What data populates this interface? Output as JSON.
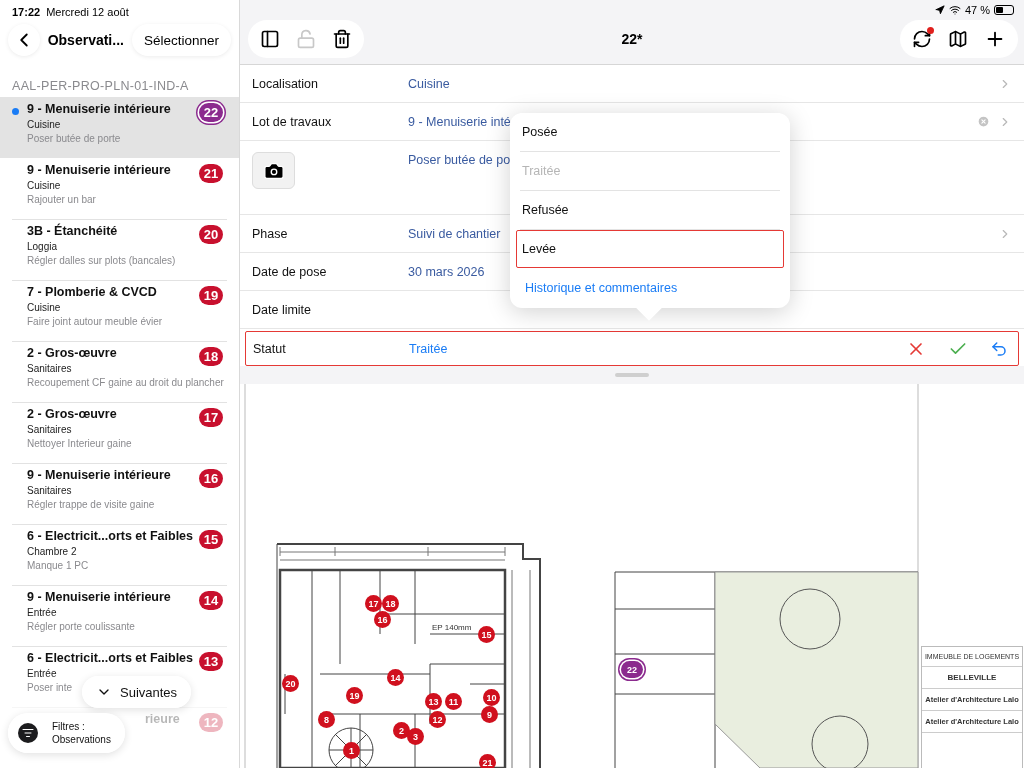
{
  "status_bar": {
    "time": "17:22",
    "date": "Mercredi 12 août",
    "battery": "47 %"
  },
  "sidebar": {
    "back_title": "Observati...",
    "select_button": "Sélectionner",
    "section": "AAL-PER-PRO-PLN-01-IND-A",
    "items": [
      {
        "title": "9 - Menuiserie intérieure",
        "room": "Cuisine",
        "description": "Poser butée de porte",
        "number": "22",
        "selected": true
      },
      {
        "title": "9 - Menuiserie intérieure",
        "room": "Cuisine",
        "description": "Rajouter un bar",
        "number": "21",
        "selected": false
      },
      {
        "title": "3B - Étanchéité",
        "room": "Loggia",
        "description": "Régler dalles sur plots (bancales)",
        "number": "20",
        "selected": false
      },
      {
        "title": "7 - Plomberie & CVCD",
        "room": "Cuisine",
        "description": "Faire joint autour meuble évier",
        "number": "19",
        "selected": false
      },
      {
        "title": "2 - Gros-œuvre",
        "room": "Sanitaires",
        "description": "Recoupement CF gaine au droit du plancher",
        "number": "18",
        "selected": false
      },
      {
        "title": "2 - Gros-œuvre",
        "room": "Sanitaires",
        "description": "Nettoyer Interieur gaine",
        "number": "17",
        "selected": false
      },
      {
        "title": "9 - Menuiserie intérieure",
        "room": "Sanitaires",
        "description": "Régler trappe de visite gaine",
        "number": "16",
        "selected": false
      },
      {
        "title": "6 - Electricit...orts et Faibles",
        "room": "Chambre 2",
        "description": "Manque 1 PC",
        "number": "15",
        "selected": false
      },
      {
        "title": "9 - Menuiserie intérieure",
        "room": "Entrée",
        "description": "Régler porte coulissante",
        "number": "14",
        "selected": false
      },
      {
        "title": "6 - Electricit...orts et Faibles",
        "room": "Entrée",
        "description": "Poser inte",
        "number": "13",
        "selected": false
      },
      {
        "title": "rieure",
        "number": "12",
        "selected": false
      }
    ]
  },
  "floating": {
    "next_button": "Suivantes",
    "filter_label": "Filtres :",
    "filter_value": "Observations"
  },
  "toolbar": {
    "title": "22*",
    "sync_pending": true,
    "lock_disabled": true
  },
  "form": {
    "rows": [
      {
        "kind": "field",
        "label": "Localisation",
        "value": "Cuisine",
        "chevron": true
      },
      {
        "kind": "field",
        "label": "Lot de travaux",
        "value": "9 - Menuiserie inté",
        "clearable": true,
        "chevron": true
      },
      {
        "kind": "photo",
        "value": "Poser butée de po"
      },
      {
        "kind": "field",
        "label": "Phase",
        "value": "Suivi de chantier",
        "chevron": true
      },
      {
        "kind": "field",
        "label": "Date de pose",
        "value": "30 mars 2026"
      },
      {
        "kind": "field",
        "label": "Date limite"
      },
      {
        "kind": "status",
        "label": "Statut",
        "value": "Traitée",
        "highlighted": true
      }
    ]
  },
  "popup": {
    "options": [
      {
        "label": "Posée",
        "disabled": false,
        "selected": false
      },
      {
        "label": "Traitée",
        "disabled": true,
        "selected": false
      },
      {
        "label": "Refusée",
        "disabled": false,
        "selected": false
      },
      {
        "label": "Levée",
        "disabled": false,
        "selected": true
      }
    ],
    "link": "Historique et commentaires"
  },
  "plan": {
    "note": "EP 140mm",
    "title_block": [
      "IMMEUBLE DE LOGEMENTS",
      "BELLEVILLE",
      "Atelier d'Architecture Lalo",
      "Atelier d'Architecture Lalo"
    ],
    "pins": [
      {
        "number": "22",
        "selected": true
      },
      {
        "number": "17",
        "selected": false
      },
      {
        "number": "18",
        "selected": false
      },
      {
        "number": "16",
        "selected": false
      },
      {
        "number": "15",
        "selected": false
      },
      {
        "number": "20",
        "selected": false
      },
      {
        "number": "14",
        "selected": false
      },
      {
        "number": "19",
        "selected": false
      },
      {
        "number": "13",
        "selected": false
      },
      {
        "number": "11",
        "selected": false
      },
      {
        "number": "10",
        "selected": false
      },
      {
        "number": "9",
        "selected": false
      },
      {
        "number": "12",
        "selected": false
      },
      {
        "number": "8",
        "selected": false
      },
      {
        "number": "2",
        "selected": false
      },
      {
        "number": "3",
        "selected": false
      },
      {
        "number": "1",
        "selected": false
      },
      {
        "number": "21",
        "selected": false
      }
    ]
  }
}
